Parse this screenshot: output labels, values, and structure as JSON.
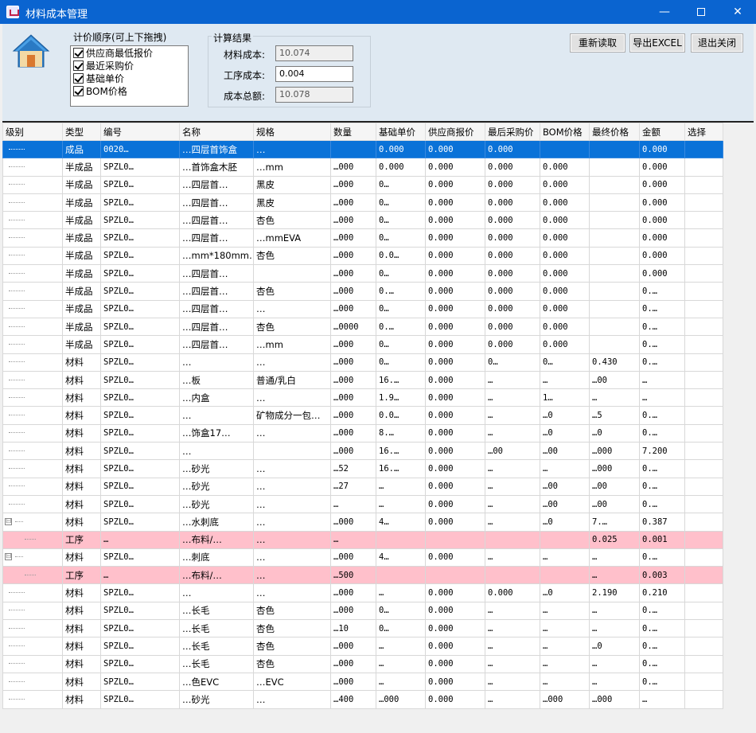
{
  "window": {
    "title": "材料成本管理",
    "min": "—",
    "close": "✕"
  },
  "order": {
    "legend": "计价顺序(可上下拖拽)",
    "items": [
      "供应商最低报价",
      "最近采购价",
      "基础单价",
      "BOM价格"
    ]
  },
  "result": {
    "legend": "计算结果",
    "material_label": "材料成本:",
    "material_value": "10.074",
    "process_label": "工序成本:",
    "process_value": "0.004",
    "total_label": "成本总额:",
    "total_value": "10.078"
  },
  "buttons": {
    "reload": "重新读取",
    "export": "导出EXCEL",
    "exit": "退出关闭"
  },
  "columns": [
    "级别",
    "类型",
    "编号",
    "名称",
    "规格",
    "数量",
    "基础单价",
    "供应商报价",
    "最后采购价",
    "BOM价格",
    "最终价格",
    "金额",
    "选择"
  ],
  "rows": [
    [
      "",
      "成品",
      "0020…",
      "…四层首饰盒",
      "…",
      "",
      "0.000",
      "0.000",
      "0.000",
      "",
      "",
      "0.000",
      ""
    ],
    [
      "",
      "半成品",
      "SPZL0…",
      "…首饰盒木胚",
      "…mm",
      "…000",
      "0.000",
      "0.000",
      "0.000",
      "0.000",
      "",
      "0.000",
      ""
    ],
    [
      "",
      "半成品",
      "SPZL0…",
      "…四层首…",
      "黑皮",
      "…000",
      "0…",
      "0.000",
      "0.000",
      "0.000",
      "",
      "0.000",
      ""
    ],
    [
      "",
      "半成品",
      "SPZL0…",
      "…四层首…",
      "黑皮",
      "…000",
      "0…",
      "0.000",
      "0.000",
      "0.000",
      "",
      "0.000",
      ""
    ],
    [
      "",
      "半成品",
      "SPZL0…",
      "…四层首…",
      "杏色",
      "…000",
      "0…",
      "0.000",
      "0.000",
      "0.000",
      "",
      "0.000",
      ""
    ],
    [
      "",
      "半成品",
      "SPZL0…",
      "…四层首…",
      "…mmEVA",
      "…000",
      "0…",
      "0.000",
      "0.000",
      "0.000",
      "",
      "0.000",
      ""
    ],
    [
      "",
      "半成品",
      "SPZL0…",
      "…mm*180mm…",
      "杏色",
      "…000",
      "0.0…",
      "0.000",
      "0.000",
      "0.000",
      "",
      "0.000",
      ""
    ],
    [
      "",
      "半成品",
      "SPZL0…",
      "…四层首…",
      "",
      "…000",
      "0…",
      "0.000",
      "0.000",
      "0.000",
      "",
      "0.000",
      ""
    ],
    [
      "",
      "半成品",
      "SPZL0…",
      "…四层首…",
      "杏色",
      "…000",
      "0.…",
      "0.000",
      "0.000",
      "0.000",
      "",
      "0.…",
      ""
    ],
    [
      "",
      "半成品",
      "SPZL0…",
      "…四层首…",
      "…",
      "…000",
      "0…",
      "0.000",
      "0.000",
      "0.000",
      "",
      "0.…",
      ""
    ],
    [
      "",
      "半成品",
      "SPZL0…",
      "…四层首…",
      "杏色",
      "…0000",
      "0.…",
      "0.000",
      "0.000",
      "0.000",
      "",
      "0.…",
      ""
    ],
    [
      "",
      "半成品",
      "SPZL0…",
      "…四层首…",
      "…mm",
      "…000",
      "0…",
      "0.000",
      "0.000",
      "0.000",
      "",
      "0.…",
      ""
    ],
    [
      "",
      "材料",
      "SPZL0…",
      "…",
      "…",
      "…000",
      "0…",
      "0.000",
      "0…",
      "0…",
      "0.430",
      "0.…",
      ""
    ],
    [
      "",
      "材料",
      "SPZL0…",
      "…板",
      "普通/乳白",
      "…000",
      "16.…",
      "0.000",
      "…",
      "…",
      "…00",
      "…",
      ""
    ],
    [
      "",
      "材料",
      "SPZL0…",
      "…内盒",
      "…",
      "…000",
      "1.9…",
      "0.000",
      "…",
      "1…",
      "…",
      "…",
      ""
    ],
    [
      "",
      "材料",
      "SPZL0…",
      "…",
      "矿物成分一包…",
      "…000",
      "0.0…",
      "0.000",
      "…",
      "…0",
      "…5",
      "0.…",
      ""
    ],
    [
      "",
      "材料",
      "SPZL0…",
      "…饰盒17…",
      "…",
      "…000",
      "8.…",
      "0.000",
      "…",
      "…0",
      "…0",
      "0.…",
      ""
    ],
    [
      "",
      "材料",
      "SPZL0…",
      "…",
      "",
      "…000",
      "16.…",
      "0.000",
      "…00",
      "…00",
      "…000",
      "7.200",
      ""
    ],
    [
      "",
      "材料",
      "SPZL0…",
      "…砂光",
      "…",
      "…52",
      "16.…",
      "0.000",
      "…",
      "…",
      "…000",
      "0.…",
      ""
    ],
    [
      "",
      "材料",
      "SPZL0…",
      "…砂光",
      "…",
      "…27",
      "…",
      "0.000",
      "…",
      "…00",
      "…00",
      "0.…",
      ""
    ],
    [
      "",
      "材料",
      "SPZL0…",
      "…砂光",
      "…",
      "…",
      "…",
      "0.000",
      "…",
      "…00",
      "…00",
      "0.…",
      ""
    ],
    [
      "⊟",
      "材料",
      "SPZL0…",
      "…水刺底",
      "…",
      "…000",
      "4…",
      "0.000",
      "…",
      "…0",
      "7.…",
      "0.387",
      ""
    ],
    [
      "",
      "工序",
      "…",
      "…布料/…",
      "…",
      "…",
      "",
      "",
      "",
      "",
      "0.025",
      "0.001",
      ""
    ],
    [
      "⊟",
      "材料",
      "SPZL0…",
      "…刺底",
      "…",
      "…000",
      "4…",
      "0.000",
      "…",
      "…",
      "…",
      "0.…",
      ""
    ],
    [
      "",
      "工序",
      "…",
      "…布料/…",
      "…",
      "…500",
      "",
      "",
      "",
      "",
      "…",
      "0.003",
      ""
    ],
    [
      "",
      "材料",
      "SPZL0…",
      "…",
      "…",
      "…000",
      "…",
      "0.000",
      "0.000",
      "…0",
      "2.190",
      "0.210",
      ""
    ],
    [
      "",
      "材料",
      "SPZL0…",
      "…长毛",
      "杏色",
      "…000",
      "0…",
      "0.000",
      "…",
      "…",
      "…",
      "0.…",
      ""
    ],
    [
      "",
      "材料",
      "SPZL0…",
      "…长毛",
      "杏色",
      "…10",
      "0…",
      "0.000",
      "…",
      "…",
      "…",
      "0.…",
      ""
    ],
    [
      "",
      "材料",
      "SPZL0…",
      "…长毛",
      "杏色",
      "…000",
      "…",
      "0.000",
      "…",
      "…",
      "…0",
      "0.…",
      ""
    ],
    [
      "",
      "材料",
      "SPZL0…",
      "…长毛",
      "杏色",
      "…000",
      "…",
      "0.000",
      "…",
      "…",
      "…",
      "0.…",
      ""
    ],
    [
      "",
      "材料",
      "SPZL0…",
      "…色EVC",
      "…EVC",
      "…000",
      "…",
      "0.000",
      "…",
      "…",
      "…",
      "0.…",
      ""
    ],
    [
      "",
      "材料",
      "SPZL0…",
      "…砂光",
      "…",
      "…400",
      "…000",
      "0.000",
      "…",
      "…000",
      "…000",
      "…",
      ""
    ]
  ],
  "row_types": [
    "sel",
    "",
    "",
    "",
    "",
    "",
    "",
    "",
    "",
    "",
    "",
    "",
    "",
    "",
    "",
    "",
    "",
    "",
    "",
    "",
    "",
    "",
    "proc",
    "",
    "proc",
    "",
    "",
    "",
    "",
    "",
    "",
    ""
  ],
  "row_tree": [
    "dot",
    "dot",
    "dot",
    "dot",
    "dot",
    "dot",
    "dot",
    "dot",
    "dot",
    "dot",
    "dot",
    "dot",
    "dot",
    "dot",
    "dot",
    "dot",
    "dot",
    "dot",
    "dot",
    "dot",
    "dot",
    "exp",
    "sub",
    "exp",
    "sub",
    "dot",
    "dot",
    "dot",
    "dot",
    "dot",
    "dot",
    "dot"
  ]
}
